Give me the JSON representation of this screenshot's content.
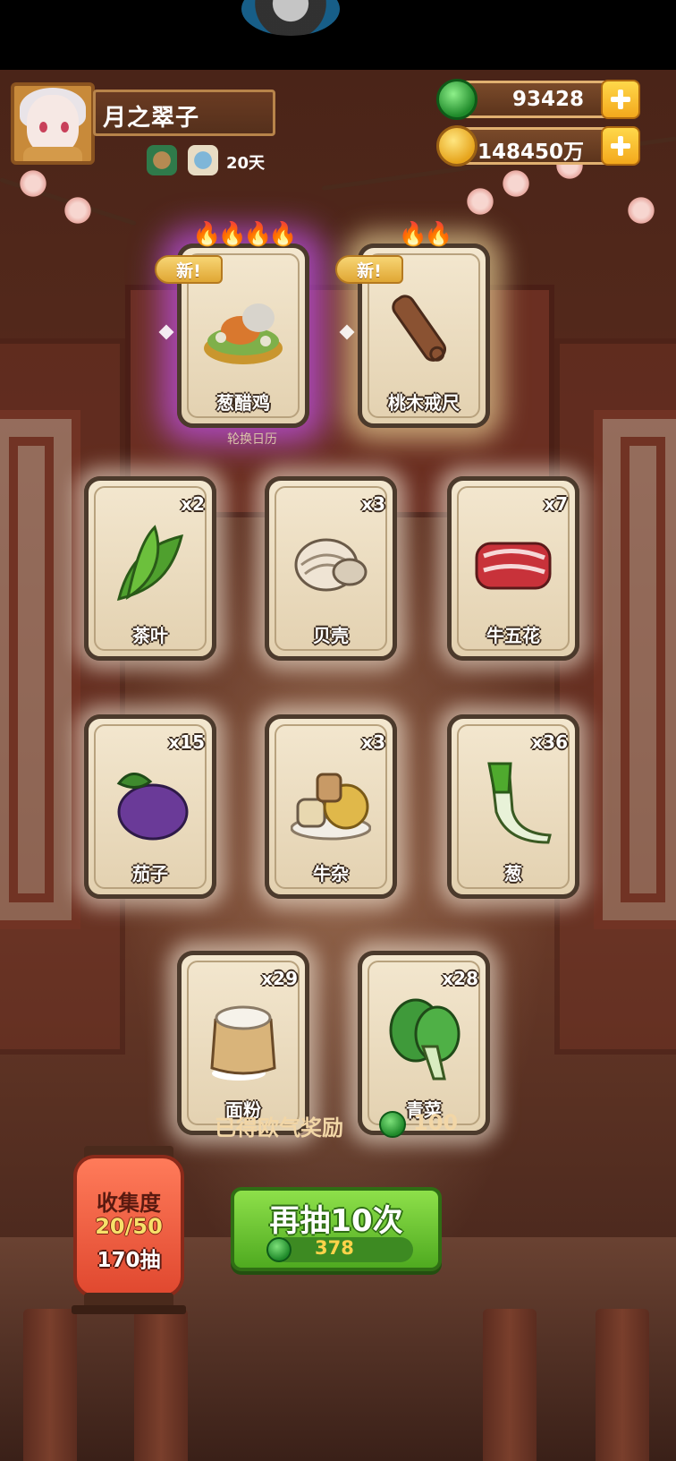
{
  "player": {
    "name": "月之翠子",
    "days": "20天"
  },
  "currency": {
    "jade": "93428",
    "gold": "148450万"
  },
  "calendar_label": "轮换日历",
  "new_label": "新!",
  "featured": [
    {
      "name": "葱醋鸡",
      "icon": "braised-chicken-pot-icon"
    },
    {
      "name": "桃木戒尺",
      "icon": "peach-wood-ruler-icon"
    }
  ],
  "cards": [
    {
      "name": "茶叶",
      "count": "x2",
      "icon": "tea-leaf-icon"
    },
    {
      "name": "贝壳",
      "count": "x3",
      "icon": "shell-icon"
    },
    {
      "name": "牛五花",
      "count": "x7",
      "icon": "beef-belly-icon"
    },
    {
      "name": "茄子",
      "count": "x15",
      "icon": "eggplant-icon"
    },
    {
      "name": "牛杂",
      "count": "x3",
      "icon": "beef-offal-icon"
    },
    {
      "name": "葱",
      "count": "x36",
      "icon": "scallion-icon"
    },
    {
      "name": "面粉",
      "count": "x29",
      "icon": "flour-sack-icon"
    },
    {
      "name": "青菜",
      "count": "x28",
      "icon": "bok-choy-icon"
    }
  ],
  "reward": {
    "label": "已得欧气奖励",
    "value": "100"
  },
  "draw_button": {
    "label": "再抽10次",
    "cost": "378"
  },
  "collection": {
    "title": "收集度",
    "progress": "20/50",
    "draws": "170抽"
  }
}
